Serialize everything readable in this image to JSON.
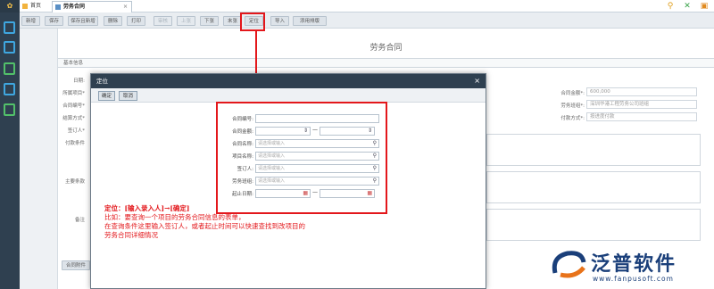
{
  "tabs": [
    {
      "label": "首页"
    },
    {
      "label": "劳务合同"
    }
  ],
  "toolbar": [
    "新增",
    "保存",
    "保存且新增",
    "删除",
    "打印",
    "审核",
    "上张",
    "下张",
    "末张",
    "定位",
    "导入",
    "添用排版"
  ],
  "page": {
    "title": "劳务合同",
    "section": "基本信息",
    "right_fields": [
      {
        "label": "合同金额*:",
        "value": "600,000"
      },
      {
        "label": "劳务班组*:",
        "value": "深圳华港工程劳务公司班组"
      },
      {
        "label": "付款方式*:",
        "value": "按进度付款"
      }
    ],
    "left_labels": [
      "日期:",
      "所属项目*",
      "合同编号*",
      "结算方式*",
      "签订人*",
      "付款条件",
      "主要条款",
      "备注"
    ],
    "attachment": "合同附件"
  },
  "modal": {
    "title": "定位",
    "close": "×",
    "buttons": [
      "确定",
      "取消"
    ],
    "fields": [
      {
        "label": "合同编号:",
        "placeholder": "",
        "type": "text"
      },
      {
        "label": "合同金额:",
        "placeholder": "",
        "type": "range-num"
      },
      {
        "label": "合同名称:",
        "placeholder": "请选择或输入",
        "type": "search"
      },
      {
        "label": "项目名称:",
        "placeholder": "请选择或输入",
        "type": "search"
      },
      {
        "label": "签订人:",
        "placeholder": "请选择或输入",
        "type": "search"
      },
      {
        "label": "劳务班组:",
        "placeholder": "请选择或输入",
        "type": "search"
      },
      {
        "label": "起止日期:",
        "placeholder": "",
        "type": "range-date"
      }
    ]
  },
  "annotation": [
    "定位：[输入录入人]→[确定]",
    "比如：要查询一个项目的劳务合同信息的表单，",
    "在查询条件这里输入签订人，或者起止时间可以快速查找到改项目的",
    "劳务合同详细情况"
  ],
  "brand": {
    "name": "泛普软件",
    "url": "www.fanpusoft.com"
  },
  "colors": {
    "accent": "#e3171b",
    "sidebar": "#2f4050",
    "brand": "#1a3f7a"
  }
}
